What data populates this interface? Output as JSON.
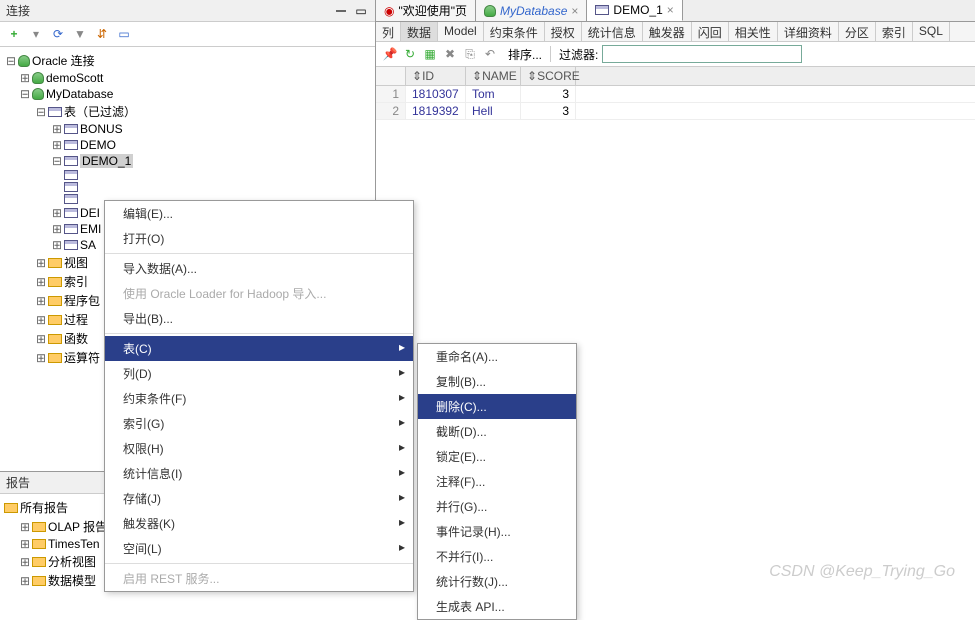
{
  "left_panel": {
    "title": "连接",
    "tree": {
      "root": "Oracle 连接",
      "nodes": [
        {
          "label": "demoScott"
        },
        {
          "label": "MyDatabase"
        }
      ],
      "tables_label": "表（已过滤）",
      "tables": [
        "BONUS",
        "DEMO",
        "DEMO_1",
        "",
        "",
        "DEI",
        "EMI",
        "SA"
      ],
      "other_nodes": [
        "视图",
        "索引",
        "程序包",
        "过程",
        "函数",
        "运算符"
      ]
    }
  },
  "reports": {
    "title": "报告",
    "items": [
      "所有报告",
      "OLAP 报告",
      "TimesTen",
      "分析视图",
      "数据模型"
    ]
  },
  "tabs": {
    "welcome": "\"欢迎使用\"页",
    "db": "MyDatabase",
    "table": "DEMO_1"
  },
  "subtabs": [
    "列",
    "数据",
    "Model",
    "约束条件",
    "授权",
    "统计信息",
    "触发器",
    "闪回",
    "相关性",
    "详细资料",
    "分区",
    "索引",
    "SQL"
  ],
  "data_toolbar": {
    "sort": "排序...",
    "filter_label": "过滤器:"
  },
  "grid": {
    "columns": [
      "ID",
      "NAME",
      "SCORE"
    ],
    "rows": [
      {
        "n": "1",
        "id": "1810307",
        "name": "Tom",
        "score": "3"
      },
      {
        "n": "2",
        "id": "1819392",
        "name": "Hell",
        "score": "3"
      }
    ]
  },
  "context_menu1": {
    "items": [
      {
        "label": "编辑(E)...",
        "type": "item"
      },
      {
        "label": "打开(O)",
        "type": "item"
      },
      {
        "type": "sep"
      },
      {
        "label": "导入数据(A)...",
        "type": "item"
      },
      {
        "label": "使用 Oracle Loader for Hadoop 导入...",
        "type": "item",
        "disabled": true
      },
      {
        "label": "导出(B)...",
        "type": "item"
      },
      {
        "type": "sep"
      },
      {
        "label": "表(C)",
        "type": "submenu",
        "selected": true
      },
      {
        "label": "列(D)",
        "type": "submenu"
      },
      {
        "label": "约束条件(F)",
        "type": "submenu"
      },
      {
        "label": "索引(G)",
        "type": "submenu"
      },
      {
        "label": "权限(H)",
        "type": "submenu"
      },
      {
        "label": "统计信息(I)",
        "type": "submenu"
      },
      {
        "label": "存储(J)",
        "type": "submenu"
      },
      {
        "label": "触发器(K)",
        "type": "submenu"
      },
      {
        "label": "空间(L)",
        "type": "submenu"
      },
      {
        "type": "sep"
      },
      {
        "label": "启用 REST 服务...",
        "type": "item",
        "disabled": true
      }
    ]
  },
  "context_menu2": {
    "items": [
      {
        "label": "重命名(A)..."
      },
      {
        "label": "复制(B)..."
      },
      {
        "label": "删除(C)...",
        "selected": true
      },
      {
        "label": "截断(D)..."
      },
      {
        "label": "锁定(E)..."
      },
      {
        "label": "注释(F)..."
      },
      {
        "label": "并行(G)..."
      },
      {
        "label": "事件记录(H)..."
      },
      {
        "label": "不并行(I)..."
      },
      {
        "label": "统计行数(J)..."
      },
      {
        "label": "生成表 API..."
      }
    ]
  },
  "watermark": "CSDN @Keep_Trying_Go"
}
